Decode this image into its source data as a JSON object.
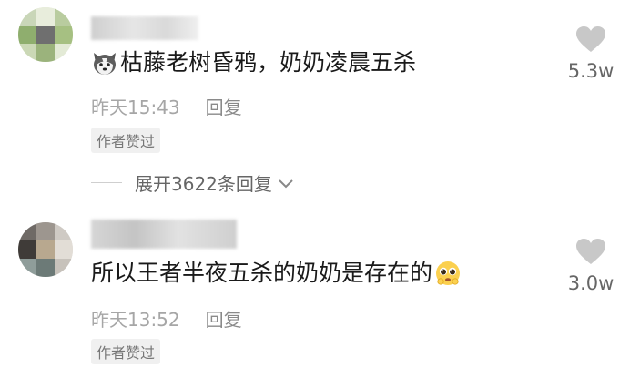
{
  "comments": [
    {
      "text": "枯藤老树昏鸦，奶奶凌晨五杀",
      "leading_emoji": "husky-face",
      "time": "昨天15:43",
      "reply_label": "回复",
      "badge": "作者赞过",
      "likes": "5.3w",
      "expand_label": "展开3622条回复"
    },
    {
      "text": "所以王者半夜五杀的奶奶是存在的",
      "trailing_emoji": "pleading-face",
      "time": "昨天13:52",
      "reply_label": "回复",
      "badge": "作者赞过",
      "likes": "3.0w"
    }
  ],
  "colors": {
    "heart": "#c8c8c8",
    "meta_text": "#a6a6a6",
    "badge_bg": "#f0f0f0"
  }
}
